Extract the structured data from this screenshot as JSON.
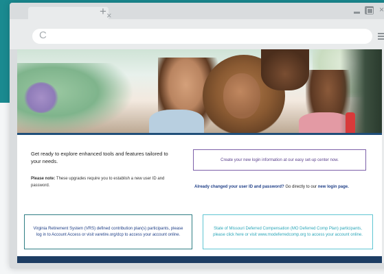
{
  "browser": {
    "tab_close_glyph": "×",
    "new_tab_glyph": "+",
    "close_glyph": "×",
    "reload_glyph": "C",
    "icons": [
      "close-icon",
      "plus-icon",
      "minimize-icon",
      "restore-icon",
      "reload-icon",
      "menu-icon"
    ]
  },
  "main": {
    "intro_heading": "Get ready to explore enhanced tools and features tailored to your needs.",
    "note_label": "Please note:",
    "note_text": " These upgrades require you to establish a new user ID and password.",
    "create_button": "Create your new login information at our easy set-up center now.",
    "already_question": "Already changed your user ID and password?",
    "already_text": " Go directly to our ",
    "login_link": "new login page.",
    "vrs_box": "Virginia Retirement System (VRS) defined contribution plan(s) participants, please log in to Account Access or visit varetire.org/dcp to access your account online.",
    "mo_box": "State of Missouri Deferred Compensation (MO Deferred Comp Plan) participants, please click here or visit www.modeferredcomp.org to access your account online."
  },
  "colors": {
    "teal": "#1a8a90",
    "navy": "#1d3d63",
    "purple": "#7b5ea8",
    "link_blue": "#1f3f87",
    "light_teal": "#2aa6b8"
  }
}
